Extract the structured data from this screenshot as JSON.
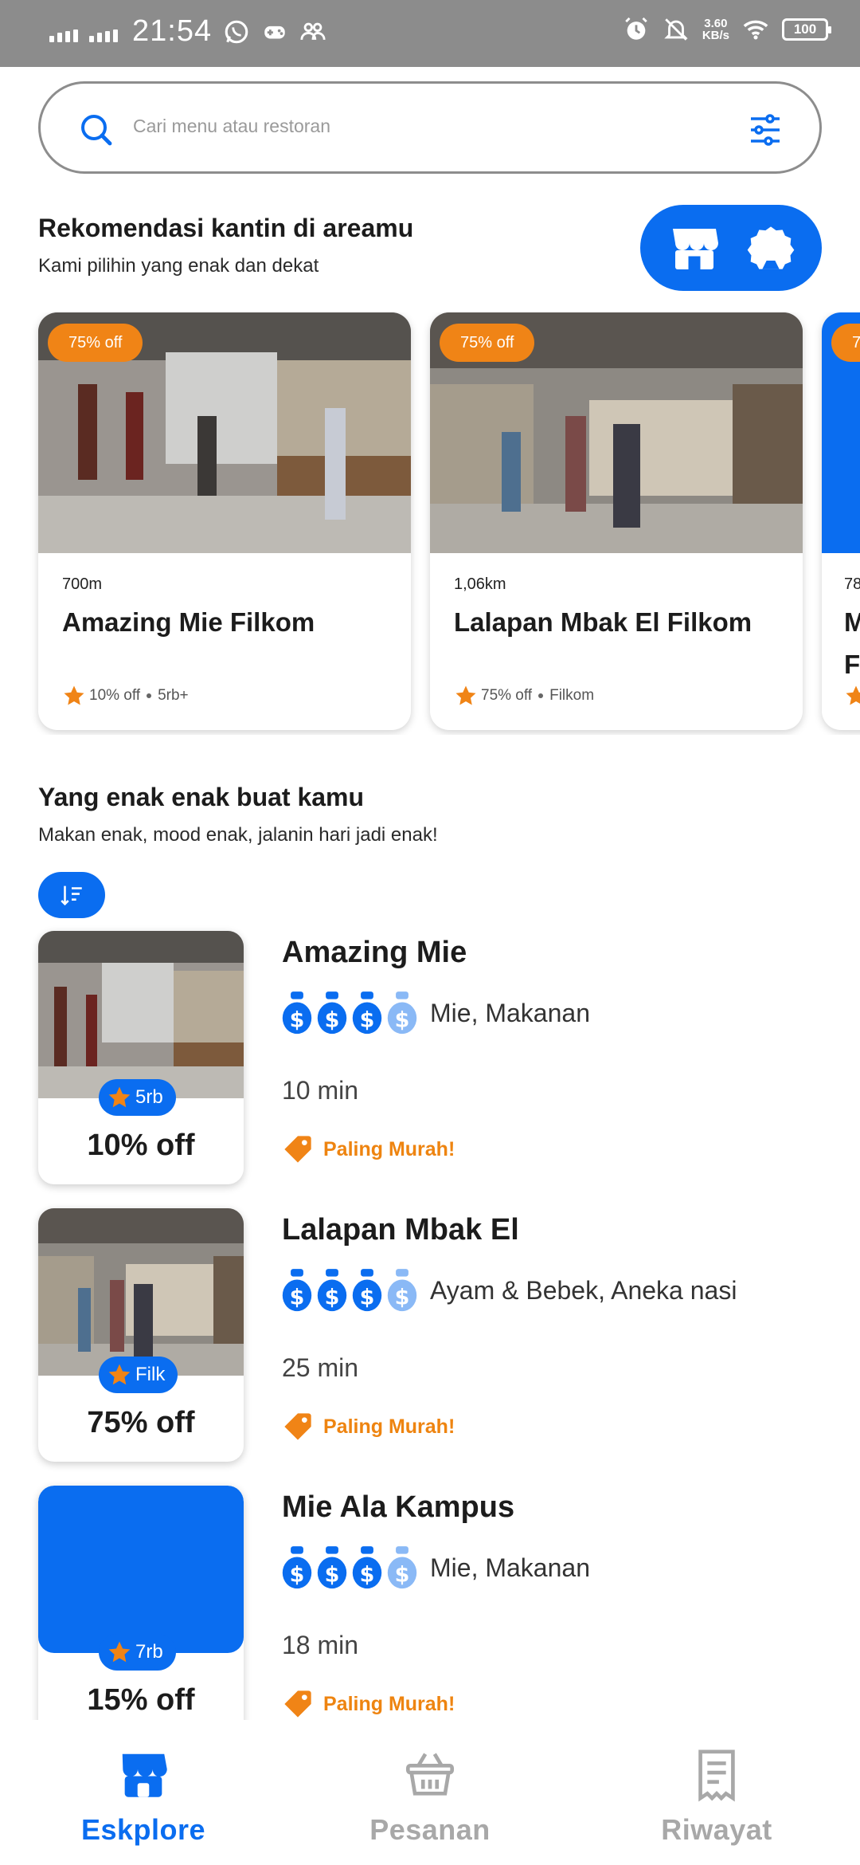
{
  "status_bar": {
    "time": "21:54",
    "net_speed_value": "3.60",
    "net_speed_unit": "KB/s",
    "battery": "100"
  },
  "search": {
    "placeholder": "Cari menu atau restoran"
  },
  "recommend": {
    "title": "Rekomendasi kantin di areamu",
    "subtitle": "Kami pilihin yang enak dan dekat",
    "cards": [
      {
        "badge": "75% off",
        "distance": "700m",
        "name": "Amazing Mie Filkom",
        "off": "10% off",
        "tag": "5rb+"
      },
      {
        "badge": "75% off",
        "distance": "1,06km",
        "name": "Lalapan Mbak El Filkom",
        "off": "75% off",
        "tag": "Filkom"
      },
      {
        "badge": "7",
        "distance": "78",
        "name": "M F",
        "off": "",
        "tag": ""
      }
    ]
  },
  "list_section": {
    "title": "Yang enak enak buat kamu",
    "subtitle": "Makan enak, mood enak, jalanin hari jadi enak!",
    "items": [
      {
        "name": "Amazing Mie",
        "cuisine": "Mie, Makanan",
        "rating": "5rb",
        "off": "10% off",
        "time": "10 min",
        "promo": "Paling Murah!"
      },
      {
        "name": "Lalapan Mbak El",
        "cuisine": "Ayam & Bebek, Aneka nasi",
        "rating": "Filk",
        "off": "75% off",
        "time": "25 min",
        "promo": "Paling Murah!"
      },
      {
        "name": "Mie Ala Kampus",
        "cuisine": "Mie, Makanan",
        "rating": "7rb",
        "off": "15% off",
        "time": "18 min",
        "promo": "Paling Murah!"
      }
    ]
  },
  "nav": {
    "explore": "Eskplore",
    "orders": "Pesanan",
    "history": "Riwayat"
  },
  "colors": {
    "primary": "#0A6DF0",
    "orange": "#F08416",
    "status_bar": "#8C8C8C"
  }
}
